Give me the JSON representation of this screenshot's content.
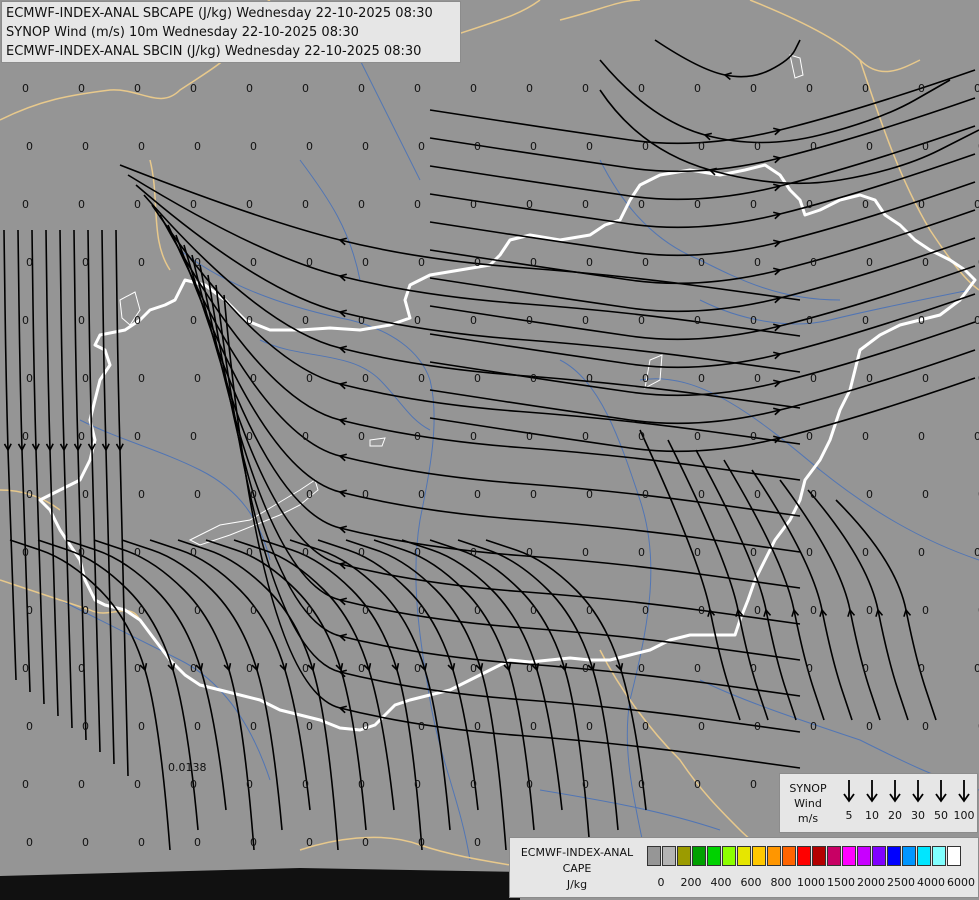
{
  "title": {
    "line1": "ECMWF-INDEX-ANAL SBCAPE (J/kg) Wednesday 22-10-2025 08:30",
    "line2": "SYNOP Wind (m/s) 10m Wednesday 22-10-2025 08:30",
    "line3": "ECMWF-INDEX-ANAL SBCIN (J/kg) Wednesday 22-10-2025 08:30"
  },
  "map_values": {
    "default": "0",
    "special": "0.0138"
  },
  "legend_wind": {
    "title": "SYNOP",
    "subtitle": "Wind",
    "unit": "m/s",
    "speeds": [
      "5",
      "10",
      "20",
      "30",
      "50",
      "100"
    ]
  },
  "legend_cape": {
    "title1": "ECMWF-INDEX-ANAL",
    "title2": "CAPE",
    "unit": "J/kg",
    "labels": [
      "0",
      "200",
      "400",
      "600",
      "800",
      "1000",
      "1500",
      "2000",
      "2500",
      "4000",
      "6000"
    ],
    "colors": [
      "#969696",
      "#b4b4b4",
      "#9b9b00",
      "#00a000",
      "#00d200",
      "#8cff00",
      "#e6e600",
      "#ffc800",
      "#ff9600",
      "#ff6400",
      "#ff0000",
      "#b40000",
      "#c80064",
      "#ff00ff",
      "#c800ff",
      "#8000ff",
      "#0000ff",
      "#0096ff",
      "#00e6ff",
      "#80ffff",
      "#ffffff"
    ]
  },
  "colors": {
    "background": "#959595",
    "hungary_border": "#ffffff",
    "country_border": "#e8c98c",
    "rivers": "#4a72b8",
    "streamlines": "#000000"
  }
}
